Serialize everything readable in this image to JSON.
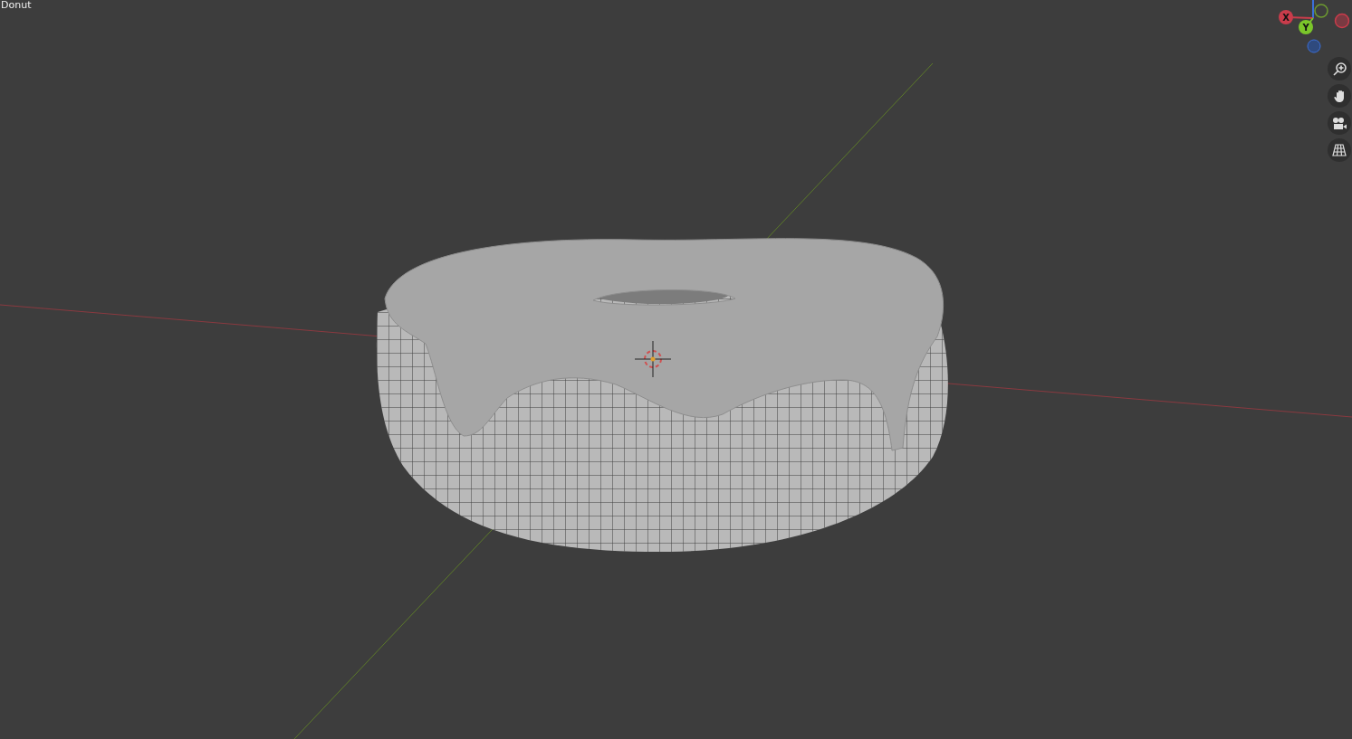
{
  "viewport": {
    "object_name": "Donut"
  },
  "gizmo": {
    "axes": [
      {
        "label": "X",
        "color": "#c93c4b"
      },
      {
        "label": "Y",
        "color": "#7bc62a"
      }
    ]
  },
  "nav_buttons": [
    {
      "kind": "zoom"
    },
    {
      "kind": "pan"
    },
    {
      "kind": "camera"
    },
    {
      "kind": "grid"
    }
  ]
}
